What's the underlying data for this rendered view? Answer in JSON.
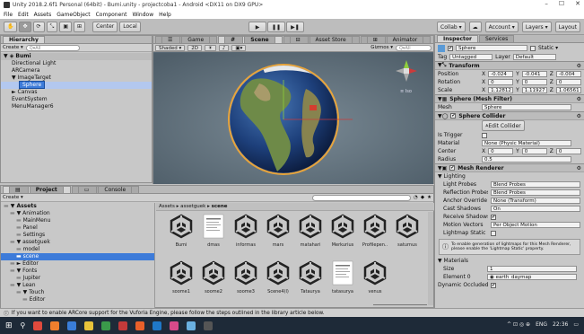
{
  "window": {
    "title": "Unity 2018.2.6f1 Personal (64bit) - Bumi.unity - projectcoba1 - Android <DX11 on DX9 GPU>",
    "minimize": "–",
    "maximize": "☐",
    "close": "✕"
  },
  "menu": [
    "File",
    "Edit",
    "Assets",
    "GameObject",
    "Component",
    "Window",
    "Help"
  ],
  "toolbar": {
    "center": "Center",
    "local": "Local",
    "collab": "Collab ▾",
    "account": "Account ▾",
    "layers": "Layers ▾",
    "layout": "Layout"
  },
  "hierarchy": {
    "tab": "Hierarchy",
    "create": "Create ▾",
    "search_placeholder": "Q▾All",
    "scene_name": "Bumi",
    "items": [
      {
        "label": "Directional Light",
        "indent": 1,
        "state": ""
      },
      {
        "label": "ARCamera",
        "indent": 1,
        "state": ""
      },
      {
        "label": "▼ ImageTarget",
        "indent": 1,
        "state": ""
      },
      {
        "label": "Sphere",
        "indent": 2,
        "state": "selected"
      },
      {
        "label": "► Canvas",
        "indent": 1,
        "state": ""
      },
      {
        "label": "EventSystem",
        "indent": 1,
        "state": ""
      },
      {
        "label": "MenuManager6",
        "indent": 1,
        "state": ""
      }
    ]
  },
  "scene_tabs": [
    {
      "label": "Game",
      "active": false
    },
    {
      "label": "Scene",
      "active": true
    },
    {
      "label": "Asset Store",
      "active": false
    },
    {
      "label": "Animator",
      "active": false
    }
  ],
  "scenebar": {
    "shading": "Shaded ▾",
    "mode2d": "2D",
    "gizmos": "Gizmos ▾",
    "search": "Q▾All",
    "persp": "≡ Iso"
  },
  "inspector": {
    "tabs": [
      "Inspector",
      "Services"
    ],
    "object_name": "Sphere",
    "static_label": "Static ▾",
    "tag_label": "Tag",
    "tag_value": "Untagged",
    "layer_label": "Layer",
    "layer_value": "Default",
    "transform": {
      "title": "Transform",
      "position": {
        "label": "Position",
        "x": "-0.024",
        "y": "-0.041",
        "z": "-0.004"
      },
      "rotation": {
        "label": "Rotation",
        "x": "0",
        "y": "0",
        "z": "0"
      },
      "scale": {
        "label": "Scale",
        "x": "1.12812",
        "y": "1.11927",
        "z": "1.06561"
      }
    },
    "mesh_filter": {
      "title": "Sphere (Mesh Filter)",
      "mesh_label": "Mesh",
      "mesh_value": "Sphere"
    },
    "sphere_collider": {
      "title": "Sphere Collider",
      "edit": "Edit Collider",
      "trigger_label": "Is Trigger",
      "material_label": "Material",
      "material_value": "None (Physic Material)",
      "center_label": "Center",
      "center": {
        "x": "0",
        "y": "0",
        "z": "0"
      },
      "radius_label": "Radius",
      "radius_value": "0.5"
    },
    "mesh_renderer": {
      "title": "Mesh Renderer",
      "lighting_label": "▼ Lighting",
      "rows": [
        {
          "label": "Light Probes",
          "value": "Blend Probes"
        },
        {
          "label": "Reflection Probes",
          "value": "Blend Probes"
        },
        {
          "label": "Anchor Override",
          "value": "None (Transform)"
        },
        {
          "label": "Cast Shadows",
          "value": "On"
        },
        {
          "label": "Receive Shadows",
          "value": "✔"
        },
        {
          "label": "Motion Vectors",
          "value": "Per Object Motion"
        },
        {
          "label": "Lightmap Static",
          "value": ""
        }
      ],
      "info": "To enable generation of lightmaps for this Mesh Renderer, please enable the 'Lightmap Static' property.",
      "materials_label": "▼ Materials",
      "size_label": "Size",
      "size_value": "1",
      "element_label": "Element 0",
      "element_value": "earth_daymap",
      "dynamic_label": "Dynamic Occluded",
      "dynamic_value": "✔"
    }
  },
  "project": {
    "tabs": [
      {
        "label": "Project",
        "active": true
      },
      {
        "label": "Console",
        "active": false
      }
    ],
    "create": "Create ▾",
    "tree": [
      {
        "label": "▼ Assets",
        "indent": 0,
        "bold": true,
        "state": ""
      },
      {
        "label": "▼ Animation",
        "indent": 1,
        "bold": false,
        "state": ""
      },
      {
        "label": "MainMenu",
        "indent": 2,
        "bold": false,
        "state": ""
      },
      {
        "label": "Panel",
        "indent": 2,
        "bold": false,
        "state": ""
      },
      {
        "label": "Settings",
        "indent": 2,
        "bold": false,
        "state": ""
      },
      {
        "label": "▼ assetguek",
        "indent": 1,
        "bold": false,
        "state": ""
      },
      {
        "label": "model",
        "indent": 2,
        "bold": false,
        "state": ""
      },
      {
        "label": "scene",
        "indent": 2,
        "bold": false,
        "state": "selected"
      },
      {
        "label": "► Editor",
        "indent": 1,
        "bold": false,
        "state": ""
      },
      {
        "label": "▼ Fonts",
        "indent": 1,
        "bold": false,
        "state": ""
      },
      {
        "label": "Jupiter",
        "indent": 2,
        "bold": false,
        "state": ""
      },
      {
        "label": "▼ Lean",
        "indent": 1,
        "bold": false,
        "state": ""
      },
      {
        "label": "▼ Touch",
        "indent": 2,
        "bold": false,
        "state": ""
      },
      {
        "label": "Editor",
        "indent": 3,
        "bold": false,
        "state": ""
      }
    ],
    "breadcrumb": [
      "Assets",
      "assetguek",
      "scene"
    ],
    "assets": [
      {
        "name": "Bumi",
        "kind": "unity"
      },
      {
        "name": "dmas",
        "kind": "doc"
      },
      {
        "name": "informas",
        "kind": "unity"
      },
      {
        "name": "mars",
        "kind": "unity"
      },
      {
        "name": "matahari",
        "kind": "unity"
      },
      {
        "name": "Merkurius",
        "kind": "unity"
      },
      {
        "name": "Profilepen..",
        "kind": "unity"
      },
      {
        "name": "saturnus",
        "kind": "unity"
      },
      {
        "name": "soome1",
        "kind": "unity"
      },
      {
        "name": "soome2",
        "kind": "unity"
      },
      {
        "name": "soome3",
        "kind": "unity"
      },
      {
        "name": "Scene4(l)",
        "kind": "unity"
      },
      {
        "name": "Tataurya",
        "kind": "unity"
      },
      {
        "name": "tatasurya",
        "kind": "doc"
      },
      {
        "name": "venus",
        "kind": "unity"
      }
    ]
  },
  "status": "If you want to enable ARCore support for the Vuforia Engine, please follow the steps outlined in the library article below.",
  "taskbar": {
    "lang": "ENG",
    "time": "22:36",
    "tray": "^ ⊡ ◎ ⊕"
  },
  "colors": {
    "selection": "#3d7bd9",
    "panel": "#c8c8c8",
    "taskbar": "#1e2a38"
  }
}
